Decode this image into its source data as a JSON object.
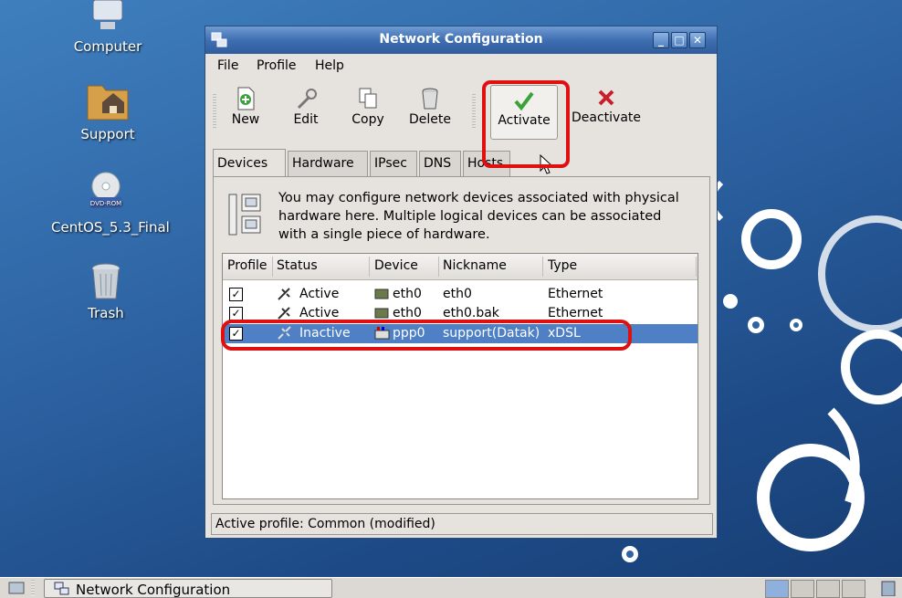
{
  "desktop": {
    "icons": [
      {
        "label": "Computer",
        "icon": "computer-icon"
      },
      {
        "label": "Support",
        "icon": "folder-icon"
      },
      {
        "label": "CentOS_5.3_Final",
        "icon": "dvd-icon"
      },
      {
        "label": "Trash",
        "icon": "trash-icon"
      }
    ],
    "dvd_label": "DVD-ROM"
  },
  "window": {
    "title": "Network Configuration",
    "controls": [
      "minimize",
      "maximize",
      "close"
    ]
  },
  "menu": {
    "file": "File",
    "profile": "Profile",
    "help": "Help"
  },
  "toolbar": {
    "new": "New",
    "edit": "Edit",
    "copy": "Copy",
    "delete": "Delete",
    "activate": "Activate",
    "deactivate": "Deactivate"
  },
  "tabs": [
    "Devices",
    "Hardware",
    "IPsec",
    "DNS",
    "Hosts"
  ],
  "active_tab": "Devices",
  "info_text": "You may configure network devices associated with physical hardware here.  Multiple logical devices can be associated with a single piece of hardware.",
  "table": {
    "columns": [
      "Profile",
      "Status",
      "Device",
      "Nickname",
      "Type"
    ],
    "rows": [
      {
        "profile": true,
        "status": "Active",
        "device": "eth0",
        "nickname": "eth0",
        "type": "Ethernet",
        "selected": false
      },
      {
        "profile": true,
        "status": "Active",
        "device": "eth0",
        "nickname": "eth0.bak",
        "type": "Ethernet",
        "selected": false
      },
      {
        "profile": true,
        "status": "Inactive",
        "device": "ppp0",
        "nickname": "support(Datak)",
        "type": "xDSL",
        "selected": true
      }
    ]
  },
  "status_bar": "Active profile: Common (modified)",
  "taskbar": {
    "task_label": "Network Configuration"
  },
  "colors": {
    "highlight": "#e01010",
    "selection": "#4f7fc4",
    "titlebar": "#3f6fb2"
  }
}
